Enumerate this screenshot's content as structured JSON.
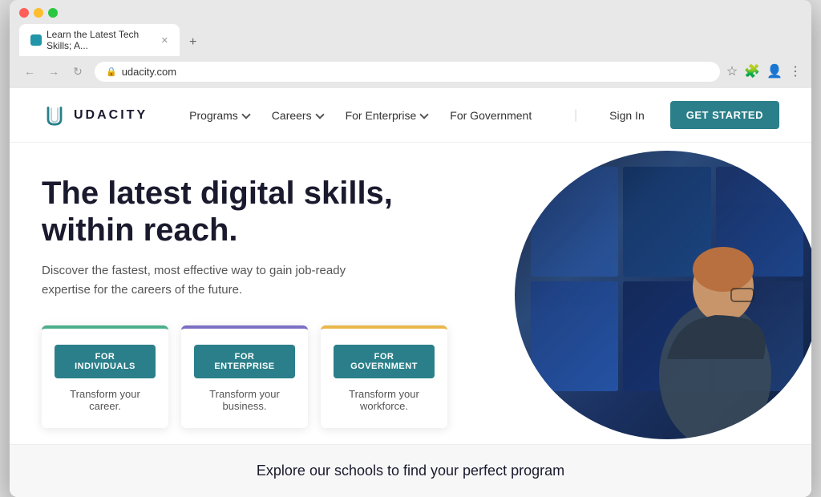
{
  "browser": {
    "tab_title": "Learn the Latest Tech Skills; A...",
    "url": "udacity.com",
    "new_tab_label": "+",
    "nav": {
      "back": "←",
      "forward": "→",
      "reload": "↻"
    }
  },
  "navbar": {
    "logo_text": "UDACITY",
    "links": [
      {
        "label": "Programs",
        "has_dropdown": true
      },
      {
        "label": "Careers",
        "has_dropdown": true
      },
      {
        "label": "For Enterprise",
        "has_dropdown": true
      },
      {
        "label": "For Government",
        "has_dropdown": false
      }
    ],
    "signin_label": "Sign In",
    "get_started_label": "GET STARTED"
  },
  "hero": {
    "title": "The latest digital skills, within reach.",
    "subtitle": "Discover the fastest, most effective way to gain job-ready expertise for the careers of the future.",
    "cards": [
      {
        "button_label": "FOR INDIVIDUALS",
        "description": "Transform your career.",
        "accent_color": "#4CAF8A"
      },
      {
        "button_label": "FOR ENTERPRISE",
        "description": "Transform your business.",
        "accent_color": "#7B6FC4"
      },
      {
        "button_label": "FOR GOVERNMENT",
        "description": "Transform your workforce.",
        "accent_color": "#E8B84B"
      }
    ]
  },
  "bottom_banner": {
    "text": "Explore our schools to find your perfect program"
  },
  "colors": {
    "brand_teal": "#2a7f8a",
    "card_green": "#4CAF8A",
    "card_purple": "#7B6FC4",
    "card_yellow": "#E8B84B"
  }
}
